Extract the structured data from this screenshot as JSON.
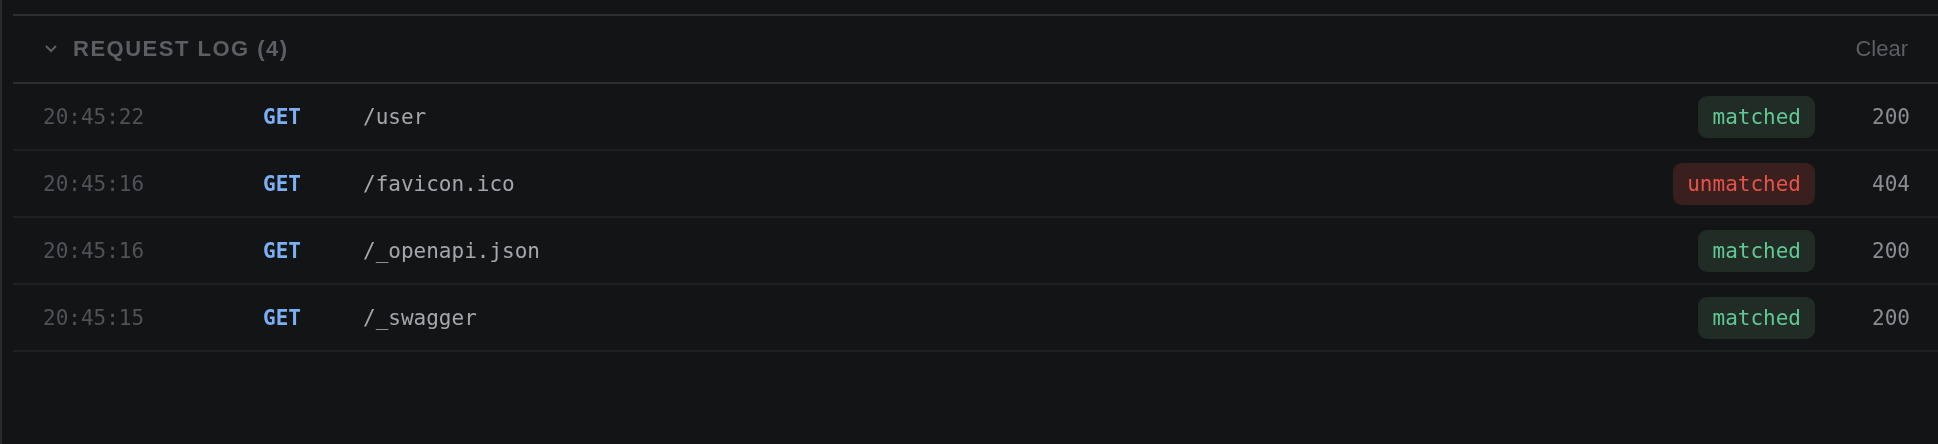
{
  "panel": {
    "title": "REQUEST LOG (4)",
    "expanded": true,
    "clear_label": "Clear"
  },
  "requests": [
    {
      "time": "20:45:22",
      "method": "GET",
      "path": "/user",
      "kind": "matched",
      "badge": "matched",
      "status": "200"
    },
    {
      "time": "20:45:16",
      "method": "GET",
      "path": "/favicon.ico",
      "kind": "unmatched",
      "badge": "unmatched",
      "status": "404"
    },
    {
      "time": "20:45:16",
      "method": "GET",
      "path": "/_openapi.json",
      "kind": "matched",
      "badge": "matched",
      "status": "200"
    },
    {
      "time": "20:45:15",
      "method": "GET",
      "path": "/_swagger",
      "kind": "matched",
      "badge": "matched",
      "status": "200"
    }
  ]
}
